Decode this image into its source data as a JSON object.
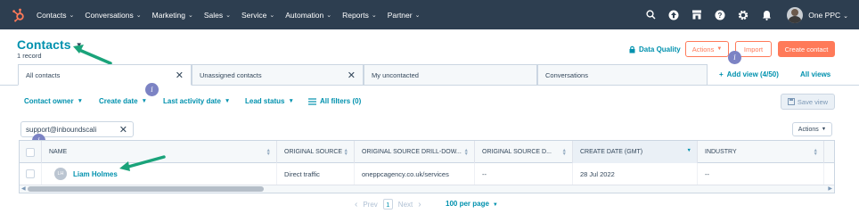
{
  "nav": {
    "logo": "hubspot-sprocket",
    "items": [
      {
        "label": "Contacts"
      },
      {
        "label": "Conversations"
      },
      {
        "label": "Marketing"
      },
      {
        "label": "Sales"
      },
      {
        "label": "Service"
      },
      {
        "label": "Automation"
      },
      {
        "label": "Reports"
      },
      {
        "label": "Partner"
      }
    ],
    "right_icons": [
      "search-icon",
      "upgrade-icon",
      "marketplace-icon",
      "help-icon",
      "settings-icon",
      "notifications-icon"
    ],
    "account_name": "One PPC",
    "bg_color": "#2d3e50"
  },
  "header": {
    "title": "Contacts",
    "record_count": "1 record",
    "data_quality_label": "Data Quality",
    "actions_label": "Actions",
    "import_label": "Import",
    "create_label": "Create contact",
    "accent_color": "#ff7a59",
    "link_color": "#0091ae"
  },
  "tabs": [
    {
      "label": "All contacts",
      "closable": true,
      "active": true
    },
    {
      "label": "Unassigned contacts",
      "closable": true,
      "active": false
    },
    {
      "label": "My uncontacted",
      "closable": false,
      "active": false
    },
    {
      "label": "Conversations",
      "closable": false,
      "active": false
    }
  ],
  "add_view_label": "Add view (4/50)",
  "all_views_label": "All views",
  "filters": {
    "contact_owner": "Contact owner",
    "create_date": "Create date",
    "last_activity": "Last activity date",
    "lead_status": "Lead status",
    "all_filters": "All filters (0)",
    "save_view": "Save view"
  },
  "search": {
    "value": "support@inboundscali"
  },
  "table": {
    "actions_label": "Actions",
    "columns": [
      {
        "label": "NAME"
      },
      {
        "label": "ORIGINAL SOURCE"
      },
      {
        "label": "ORIGINAL SOURCE DRILL-DOW..."
      },
      {
        "label": "ORIGINAL SOURCE D..."
      },
      {
        "label": "CREATE DATE (GMT)",
        "sorted": true
      },
      {
        "label": "INDUSTRY"
      }
    ],
    "rows": [
      {
        "initials": "LH",
        "name": "Liam Holmes",
        "original_source": "Direct traffic",
        "drill_down_1": "oneppcagency.co.uk/services",
        "drill_down_2": "--",
        "create_date": "28 Jul 2022",
        "industry": "--"
      }
    ]
  },
  "pagination": {
    "prev": "Prev",
    "page": "1",
    "next": "Next",
    "per_page": "100 per page"
  },
  "annotations": {
    "info_marker": "i",
    "arrow_color": "#1aa37a"
  }
}
